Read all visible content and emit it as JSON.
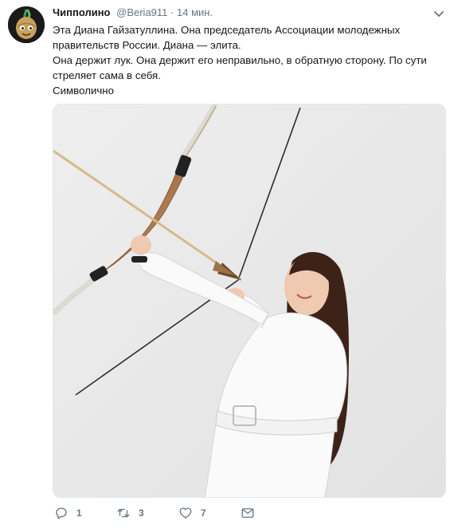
{
  "tweet": {
    "author_name": "Чипполино",
    "author_handle": "@Beria911",
    "separator": "·",
    "time": "14 мин.",
    "text_lines": [
      "Эта Диана Гайзатуллина. Она председатель Ассоциации молодежных правительств России. Диана — элита.",
      "Она держит лук. Она держит его неправильно, в обратную сторону. По сути стреляет сама в себя.",
      "Символично"
    ]
  },
  "actions": {
    "reply_count": "1",
    "retweet_count": "3",
    "like_count": "7"
  },
  "icons": {
    "avatar": "onion-cartoon-avatar",
    "caret": "chevron-down-icon",
    "reply": "reply-icon",
    "retweet": "retweet-icon",
    "like": "heart-icon",
    "dm": "envelope-icon"
  },
  "colors": {
    "text": "#14171a",
    "muted": "#657786",
    "border": "#e1e8ed"
  }
}
